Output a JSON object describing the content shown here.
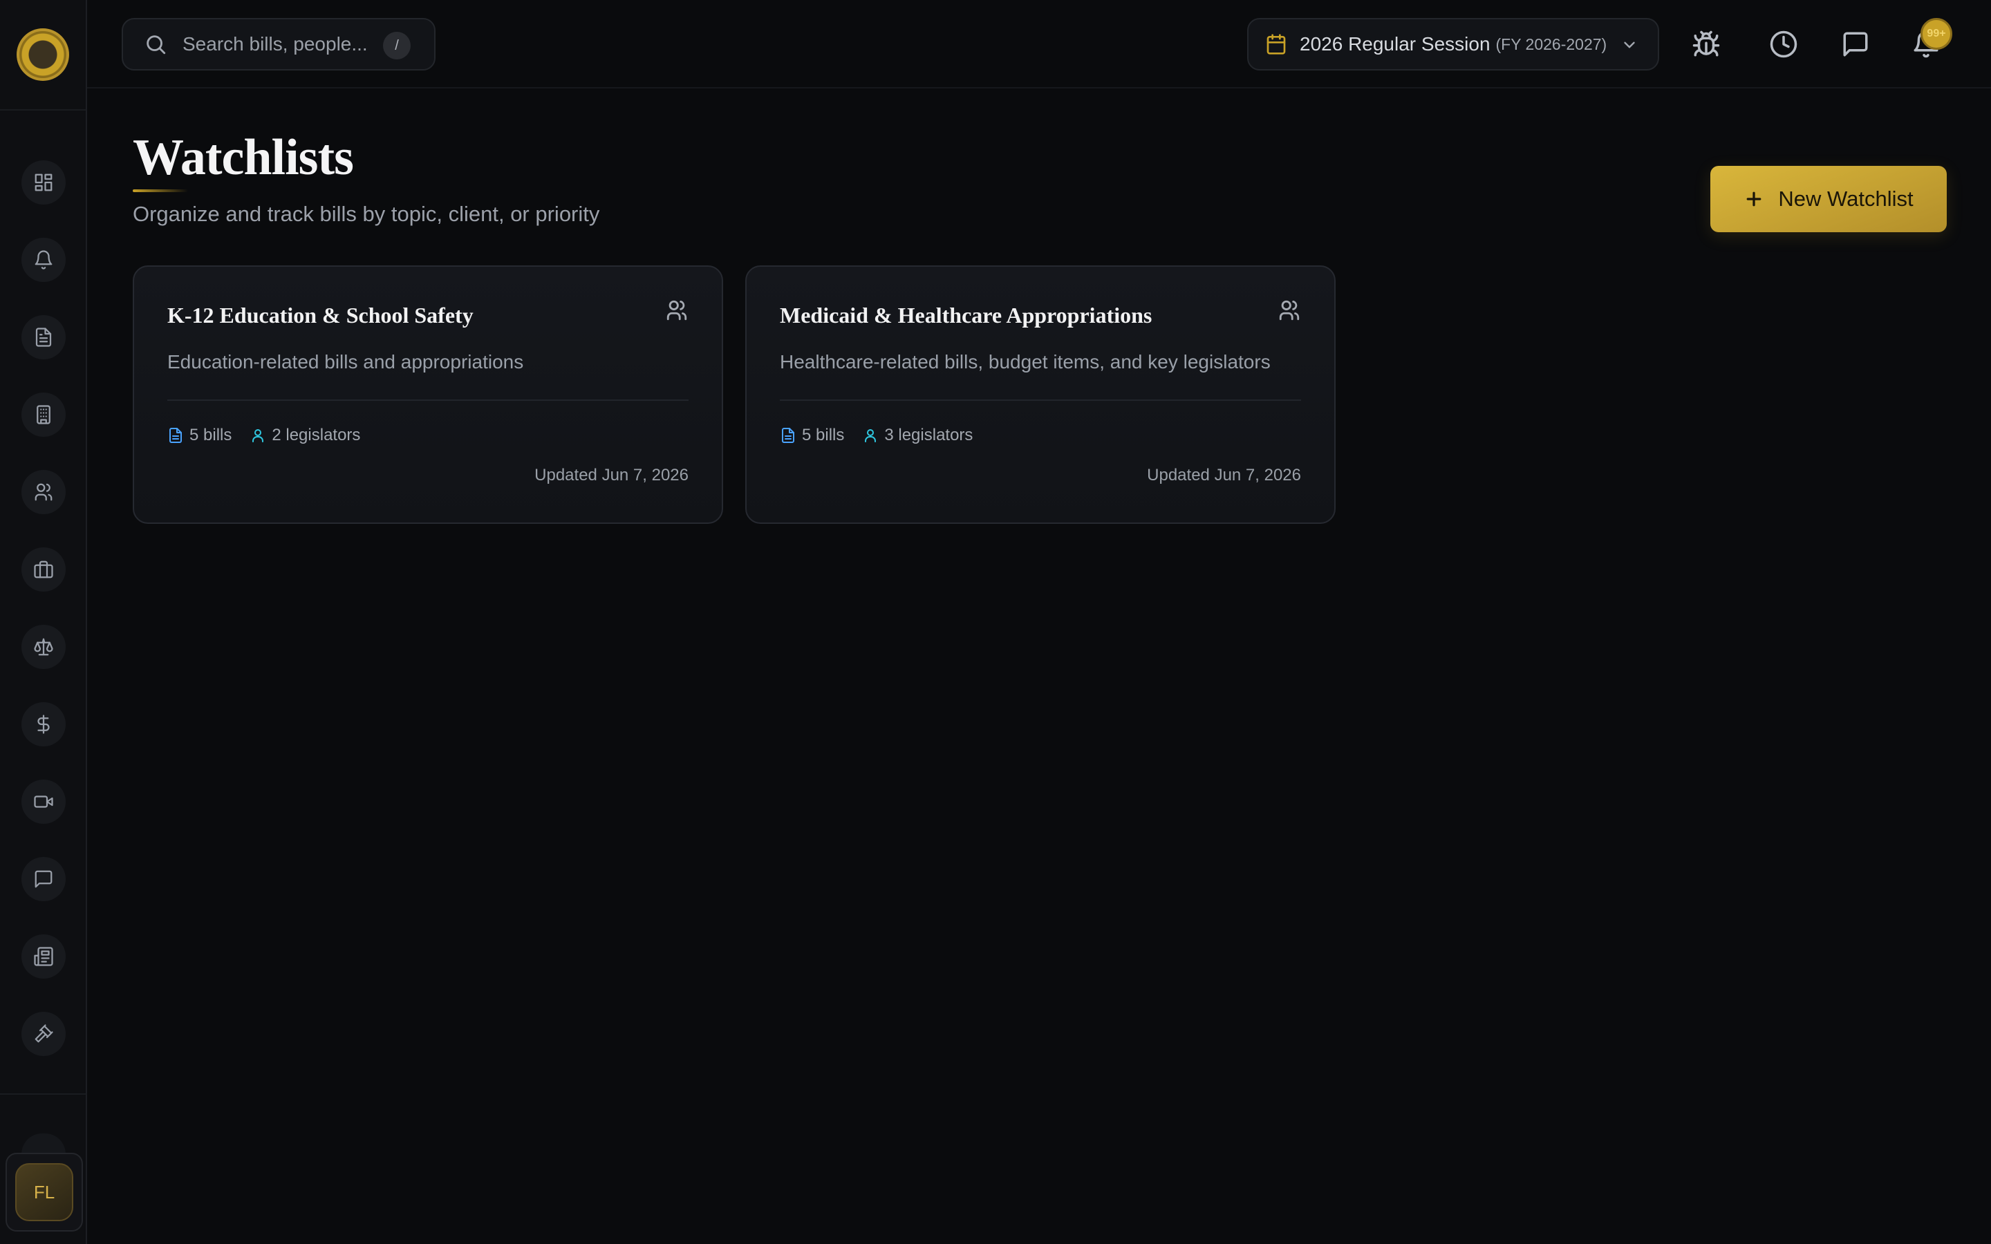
{
  "search": {
    "placeholder": "Search bills, people...",
    "shortcut": "/"
  },
  "session": {
    "name": "2026 Regular Session",
    "fiscal_year": "(FY 2026-2027)"
  },
  "notifications": {
    "badge": "99+"
  },
  "topbar_icons": [
    "bug-icon",
    "clock-icon",
    "message-icon",
    "bell-icon"
  ],
  "sidebar": {
    "items": [
      {
        "icon": "dashboard-icon"
      },
      {
        "icon": "bell-icon"
      },
      {
        "icon": "document-icon"
      },
      {
        "icon": "building-icon"
      },
      {
        "icon": "users-icon"
      },
      {
        "icon": "briefcase-icon"
      },
      {
        "icon": "scale-icon"
      },
      {
        "icon": "dollar-icon"
      },
      {
        "icon": "video-icon"
      },
      {
        "icon": "message-icon"
      },
      {
        "icon": "newspaper-icon"
      },
      {
        "icon": "gavel-icon"
      }
    ],
    "user_initials": "FL"
  },
  "page": {
    "title": "Watchlists",
    "subtitle": "Organize and track bills by topic, client, or priority",
    "new_button": "New Watchlist"
  },
  "watchlists": [
    {
      "title": "K-12 Education & School Safety",
      "description": "Education-related bills and appropriations",
      "bills": "5 bills",
      "legislators": "2 legislators",
      "updated": "Updated Jun 7, 2026"
    },
    {
      "title": "Medicaid & Healthcare Appropriations",
      "description": "Healthcare-related bills, budget items, and key legislators",
      "bills": "5 bills",
      "legislators": "3 legislators",
      "updated": "Updated Jun 7, 2026"
    }
  ],
  "colors": {
    "background": "#0a0b0d",
    "accent_gold": "#c9a227",
    "bills_icon": "#4aa3ff",
    "legislators_icon": "#2fc7e0"
  }
}
